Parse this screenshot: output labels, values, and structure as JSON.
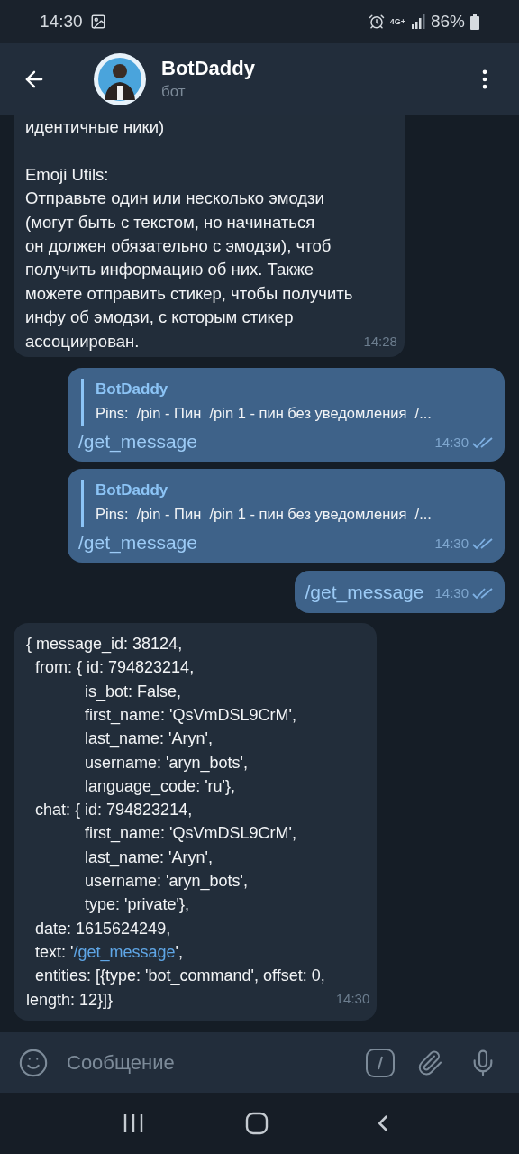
{
  "status_bar": {
    "time": "14:30",
    "network": "4G+",
    "battery": "86%"
  },
  "header": {
    "title": "BotDaddy",
    "subtitle": "бот"
  },
  "messages": [
    {
      "kind": "text",
      "text": "идентичные ники)\n\nEmoji Utils:\nОтправьте один или несколько эмодзи\n(могут быть с текстом, но начинаться\nон должен обязательно с эмодзи), чтоб\nполучить информацию об них. Также\nможете отправить стикер, чтобы получить\nинфу об эмодзи, с которым стикер\nассоциирован.",
      "time": "14:28"
    },
    {
      "kind": "reply",
      "reply_name": "BotDaddy",
      "reply_preview": "Pins:  /pin - Пин  /pin 1 - пин без уведомления  /...",
      "command": "/get_message",
      "time": "14:30",
      "read": true
    },
    {
      "kind": "reply",
      "reply_name": "BotDaddy",
      "reply_preview": "Pins:  /pin - Пин  /pin 1 - пин без уведомления  /...",
      "command": "/get_message",
      "time": "14:30",
      "read": true
    },
    {
      "kind": "command",
      "command": "/get_message",
      "time": "14:30",
      "read": true
    },
    {
      "kind": "code",
      "segments": [
        {
          "kind": "plain",
          "text": "{ message_id: 38124,\n  from: { id: 794823214,\n             is_bot: False,\n             first_name: 'QsVmDSL9CrM',\n             last_name: 'Aryn',\n             username: 'aryn_bots',\n             language_code: 'ru'},\n  chat: { id: 794823214,\n             first_name: 'QsVmDSL9CrM',\n             last_name: 'Aryn',\n             username: 'aryn_bots',\n             type: 'private'},\n  date: 1615624249,\n  text: '"
        },
        {
          "kind": "link",
          "text": "/get_message"
        },
        {
          "kind": "plain",
          "text": "',\n  entities: [{type: 'bot_command', offset: 0,\nlength: 12}]}"
        }
      ],
      "time": "14:30"
    }
  ],
  "composer": {
    "placeholder": "Сообщение"
  }
}
